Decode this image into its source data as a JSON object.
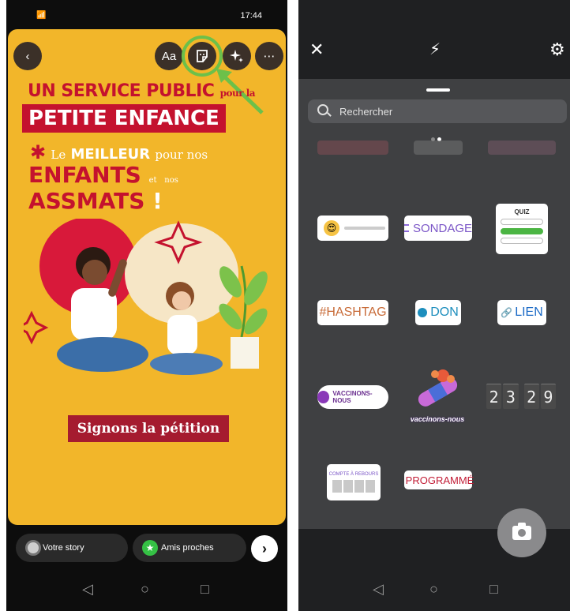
{
  "left": {
    "status": {
      "signal": "📶",
      "time": "17:44",
      "battery": "▮"
    },
    "toolbar": {
      "back": "‹",
      "text_tool": "Aa",
      "more": "⋯"
    },
    "story": {
      "line1_main": "UN SERVICE PUBLIC",
      "line1_small": "pour la",
      "line2": "PETITE ENFANCE",
      "line3_star": "✱",
      "line3_le": "Le",
      "line3_bold": "MEILLEUR",
      "line3_rest": "pour nos",
      "line4_enfants": "ENFANTS",
      "line4_et": "et",
      "line4_nos": "nos",
      "line4_assmats": "ASSMATS",
      "line4_excl": "!",
      "petition_button": "Signons la pétition"
    },
    "share": {
      "your_story": "Votre story",
      "close_friends": "Amis proches",
      "next": "›"
    },
    "nav": {
      "back": "◁",
      "home": "○",
      "recent": "□"
    }
  },
  "right": {
    "top": {
      "close": "✕",
      "flash": "⚡",
      "settings": "⚙"
    },
    "search": {
      "placeholder": "Rechercher"
    },
    "stickers": {
      "slider_emoji": "😍",
      "poll": "SONDAGE",
      "quiz_title": "QUIZ",
      "hashtag": "#HASHTAG",
      "donate": "DON",
      "link": "LIEN",
      "link_icon": "🔗",
      "vaccinons_chip": "VACCINONS-NOUS",
      "vaccinons_art": "vaccinons-nous",
      "countdown_title": "COMPTE À REBOURS",
      "scheduled": "PROGRAMMÉ",
      "digits": [
        "2",
        "3",
        "2",
        "9"
      ]
    },
    "nav": {
      "back": "◁",
      "home": "○",
      "recent": "□"
    }
  },
  "colors": {
    "story_bg": "#f2b62a",
    "brand_red": "#c4122e",
    "highlight_green": "#6cc04a",
    "tray_bg": "#3f4042"
  }
}
